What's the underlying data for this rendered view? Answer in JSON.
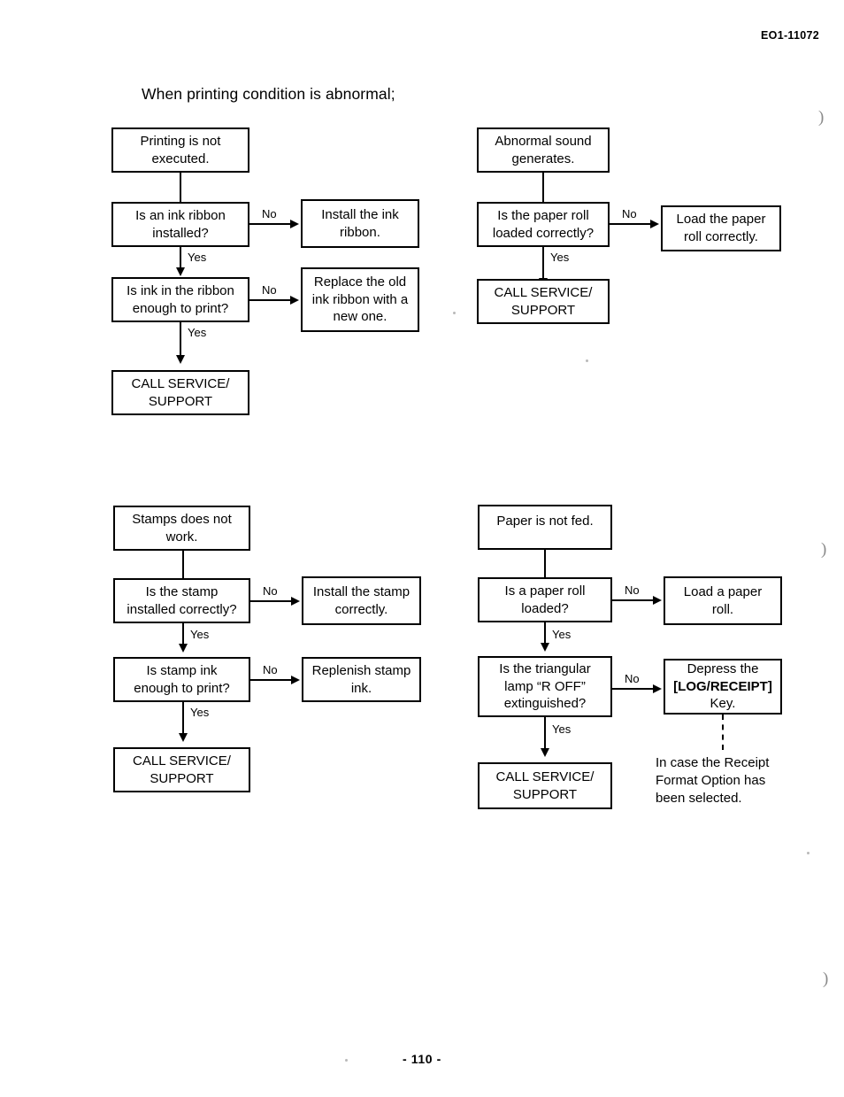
{
  "document": {
    "code": "EO1-11072",
    "page_number": "- 110 -",
    "section_title": "When printing condition is abnormal;"
  },
  "labels": {
    "yes": "Yes",
    "no": "No"
  },
  "flowcharts": [
    {
      "id": "printing-not-executed",
      "start": "Printing is not\nexecuted.",
      "steps": [
        {
          "question": "Is an ink ribbon\ninstalled?",
          "no_action": "Install the ink\nribbon."
        },
        {
          "question": "Is ink in the ribbon\nenough to print?",
          "no_action": "Replace the old\nink ribbon with a\nnew one."
        }
      ],
      "end": "CALL SERVICE/\nSUPPORT"
    },
    {
      "id": "abnormal-sound",
      "start": "Abnormal sound\ngenerates.",
      "steps": [
        {
          "question": "Is the paper roll\nloaded correctly?",
          "no_action": "Load the paper\nroll correctly."
        }
      ],
      "end": "CALL SERVICE/\nSUPPORT"
    },
    {
      "id": "stamps-not-working",
      "start": "Stamps does not\nwork.",
      "steps": [
        {
          "question": "Is the stamp\ninstalled correctly?",
          "no_action": "Install the stamp\ncorrectly."
        },
        {
          "question": "Is stamp ink\nenough to print?",
          "no_action": "Replenish stamp\nink."
        }
      ],
      "end": "CALL SERVICE/\nSUPPORT"
    },
    {
      "id": "paper-not-fed",
      "start": "Paper is not fed.",
      "steps": [
        {
          "question": "Is a paper roll\nloaded?",
          "no_action": "Load a paper\nroll."
        },
        {
          "question": "Is the triangular\nlamp “R OFF”\nextinguished?",
          "no_action_line1": "Depress the",
          "no_action_key": "[LOG/RECEIPT]",
          "no_action_line3": "Key."
        }
      ],
      "end": "CALL SERVICE/\nSUPPORT",
      "note": "In case the Receipt\nFormat Option has\nbeen selected."
    }
  ],
  "margin_marks": [
    ")",
    ")",
    ")"
  ]
}
